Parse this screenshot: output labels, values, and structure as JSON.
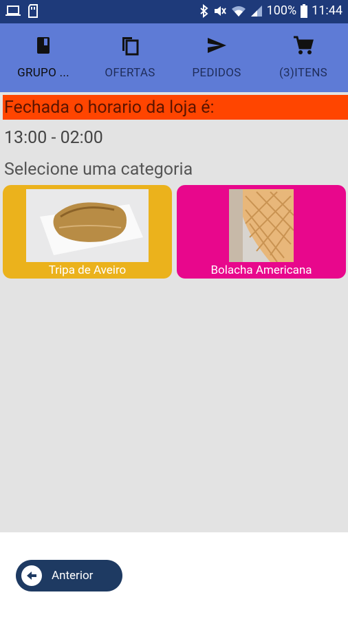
{
  "status_bar": {
    "battery": "100%",
    "time": "11:44"
  },
  "tabs": [
    {
      "label": "GRUPO ...",
      "icon": "book-icon",
      "active": true
    },
    {
      "label": "OFERTAS",
      "icon": "copy-icon",
      "active": false
    },
    {
      "label": "PEDIDOS",
      "icon": "send-icon",
      "active": false
    },
    {
      "label": "(3)ITENS",
      "icon": "cart-icon",
      "active": false
    }
  ],
  "store": {
    "closed_message": "Fechada o horario da loja é:",
    "hours": "13:00 - 02:00"
  },
  "prompt": "Selecione uma categoria",
  "categories": [
    {
      "label": "Tripa de Aveiro",
      "color": "#ebb21c"
    },
    {
      "label": "Bolacha Americana",
      "color": "#e8078c"
    }
  ],
  "footer": {
    "prev_label": "Anterior"
  },
  "colors": {
    "status_bar": "#1e3a7a",
    "app_bar": "#5e7bd6",
    "banner": "#ff4500",
    "button": "#1e3a62"
  }
}
